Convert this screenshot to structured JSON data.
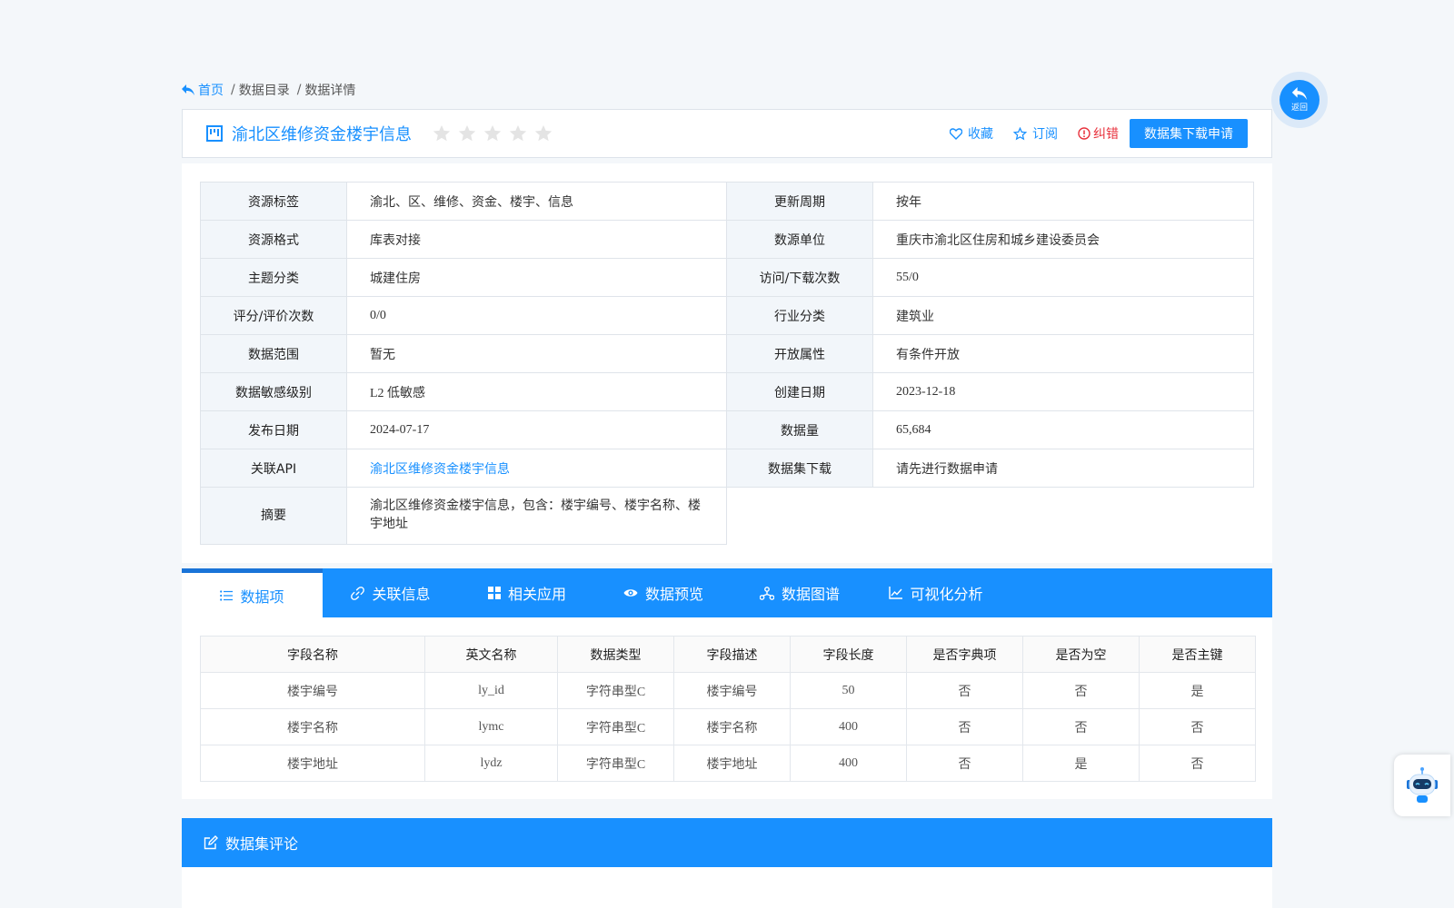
{
  "breadcrumb": {
    "home": "首页",
    "items": [
      "数据目录",
      "数据详情"
    ]
  },
  "dataset": {
    "title": "渝北区维修资金楼宇信息",
    "rating_stars": 0,
    "star_count": 5
  },
  "actions": {
    "favorite": "收藏",
    "subscribe": "订阅",
    "report_error": "纠错",
    "apply_download": "数据集下载申请"
  },
  "info": {
    "r1": {
      "l1": "资源标签",
      "v1": "渝北、区、维修、资金、楼宇、信息",
      "l2": "更新周期",
      "v2": "按年"
    },
    "r2": {
      "l1": "资源格式",
      "v1": "库表对接",
      "l2": "数源单位",
      "v2": "重庆市渝北区住房和城乡建设委员会"
    },
    "r3": {
      "l1": "主题分类",
      "v1": "城建住房",
      "l2": "访问/下载次数",
      "v2": "55/0"
    },
    "r4": {
      "l1": "评分/评价次数",
      "v1": "0/0",
      "l2": "行业分类",
      "v2": "建筑业"
    },
    "r5": {
      "l1": "数据范围",
      "v1": "暂无",
      "l2": "开放属性",
      "v2": "有条件开放"
    },
    "r6": {
      "l1": "数据敏感级别",
      "v1": "L2 低敏感",
      "l2": "创建日期",
      "v2": "2023-12-18"
    },
    "r7": {
      "l1": "发布日期",
      "v1": "2024-07-17",
      "l2": "数据量",
      "v2": "65,684"
    },
    "r8": {
      "l1": "关联API",
      "v1": "渝北区维修资金楼宇信息",
      "l2": "数据集下载",
      "v2": "请先进行数据申请"
    },
    "r9": {
      "l1": "摘要",
      "v1": "渝北区维修资金楼宇信息，包含：楼宇编号、楼宇名称、楼宇地址"
    }
  },
  "tabs": [
    "数据项",
    "关联信息",
    "相关应用",
    "数据预览",
    "数据图谱",
    "可视化分析"
  ],
  "fields": {
    "headers": [
      "字段名称",
      "英文名称",
      "数据类型",
      "字段描述",
      "字段长度",
      "是否字典项",
      "是否为空",
      "是否主键"
    ],
    "rows": [
      [
        "楼宇编号",
        "ly_id",
        "字符串型C",
        "楼宇编号",
        "50",
        "否",
        "否",
        "是"
      ],
      [
        "楼宇名称",
        "lymc",
        "字符串型C",
        "楼宇名称",
        "400",
        "否",
        "否",
        "否"
      ],
      [
        "楼宇地址",
        "lydz",
        "字符串型C",
        "楼宇地址",
        "400",
        "否",
        "是",
        "否"
      ]
    ]
  },
  "comments": {
    "title": "数据集评论"
  },
  "float": {
    "back_label": "返回"
  },
  "colors": {
    "primary": "#1890ff",
    "error": "#e8323d",
    "label_bg": "#f2f6fa"
  }
}
